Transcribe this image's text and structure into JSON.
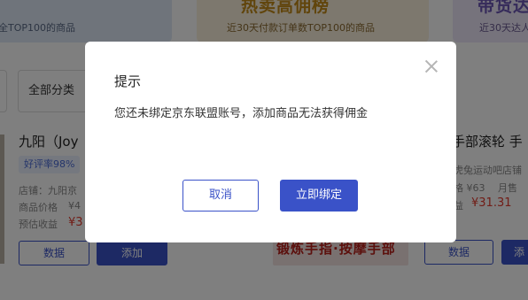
{
  "banners": [
    {
      "title": "",
      "sub": "全TOP100的商品"
    },
    {
      "title": "热卖高佣榜",
      "sub": "近30天付款订单数TOP100的商品"
    },
    {
      "title": "带货达",
      "sub": "近30天达人"
    }
  ],
  "filter": {
    "all_label": "全部分类"
  },
  "product_left": {
    "title": "九阳（Joy",
    "rate_badge": "好评率98%",
    "shop": "店铺：九阳京",
    "price_label": "商品价格",
    "price_value": "¥4",
    "income_label": "预估收益",
    "income_value": "¥3",
    "data_btn": "数据",
    "add_btn": "添加"
  },
  "product_right": {
    "title": "手部滚轮 手",
    "shop": "虎兔运动吧店铺",
    "price": "格 ¥63",
    "sales": "月售",
    "income_label": "益",
    "income_value": "¥31.31",
    "promo_text": "锻炼手指·按摩手部",
    "data_btn": "数据",
    "add_btn": "添"
  },
  "dialog": {
    "title": "提示",
    "message": "您还未绑定京东联盟账号，添加商品无法获得佣金",
    "cancel": "取消",
    "confirm": "立即绑定"
  },
  "colors": {
    "accent": "#3a52c8",
    "price": "#e23b2e",
    "overlay": "rgba(0,0,0,0.5)"
  }
}
